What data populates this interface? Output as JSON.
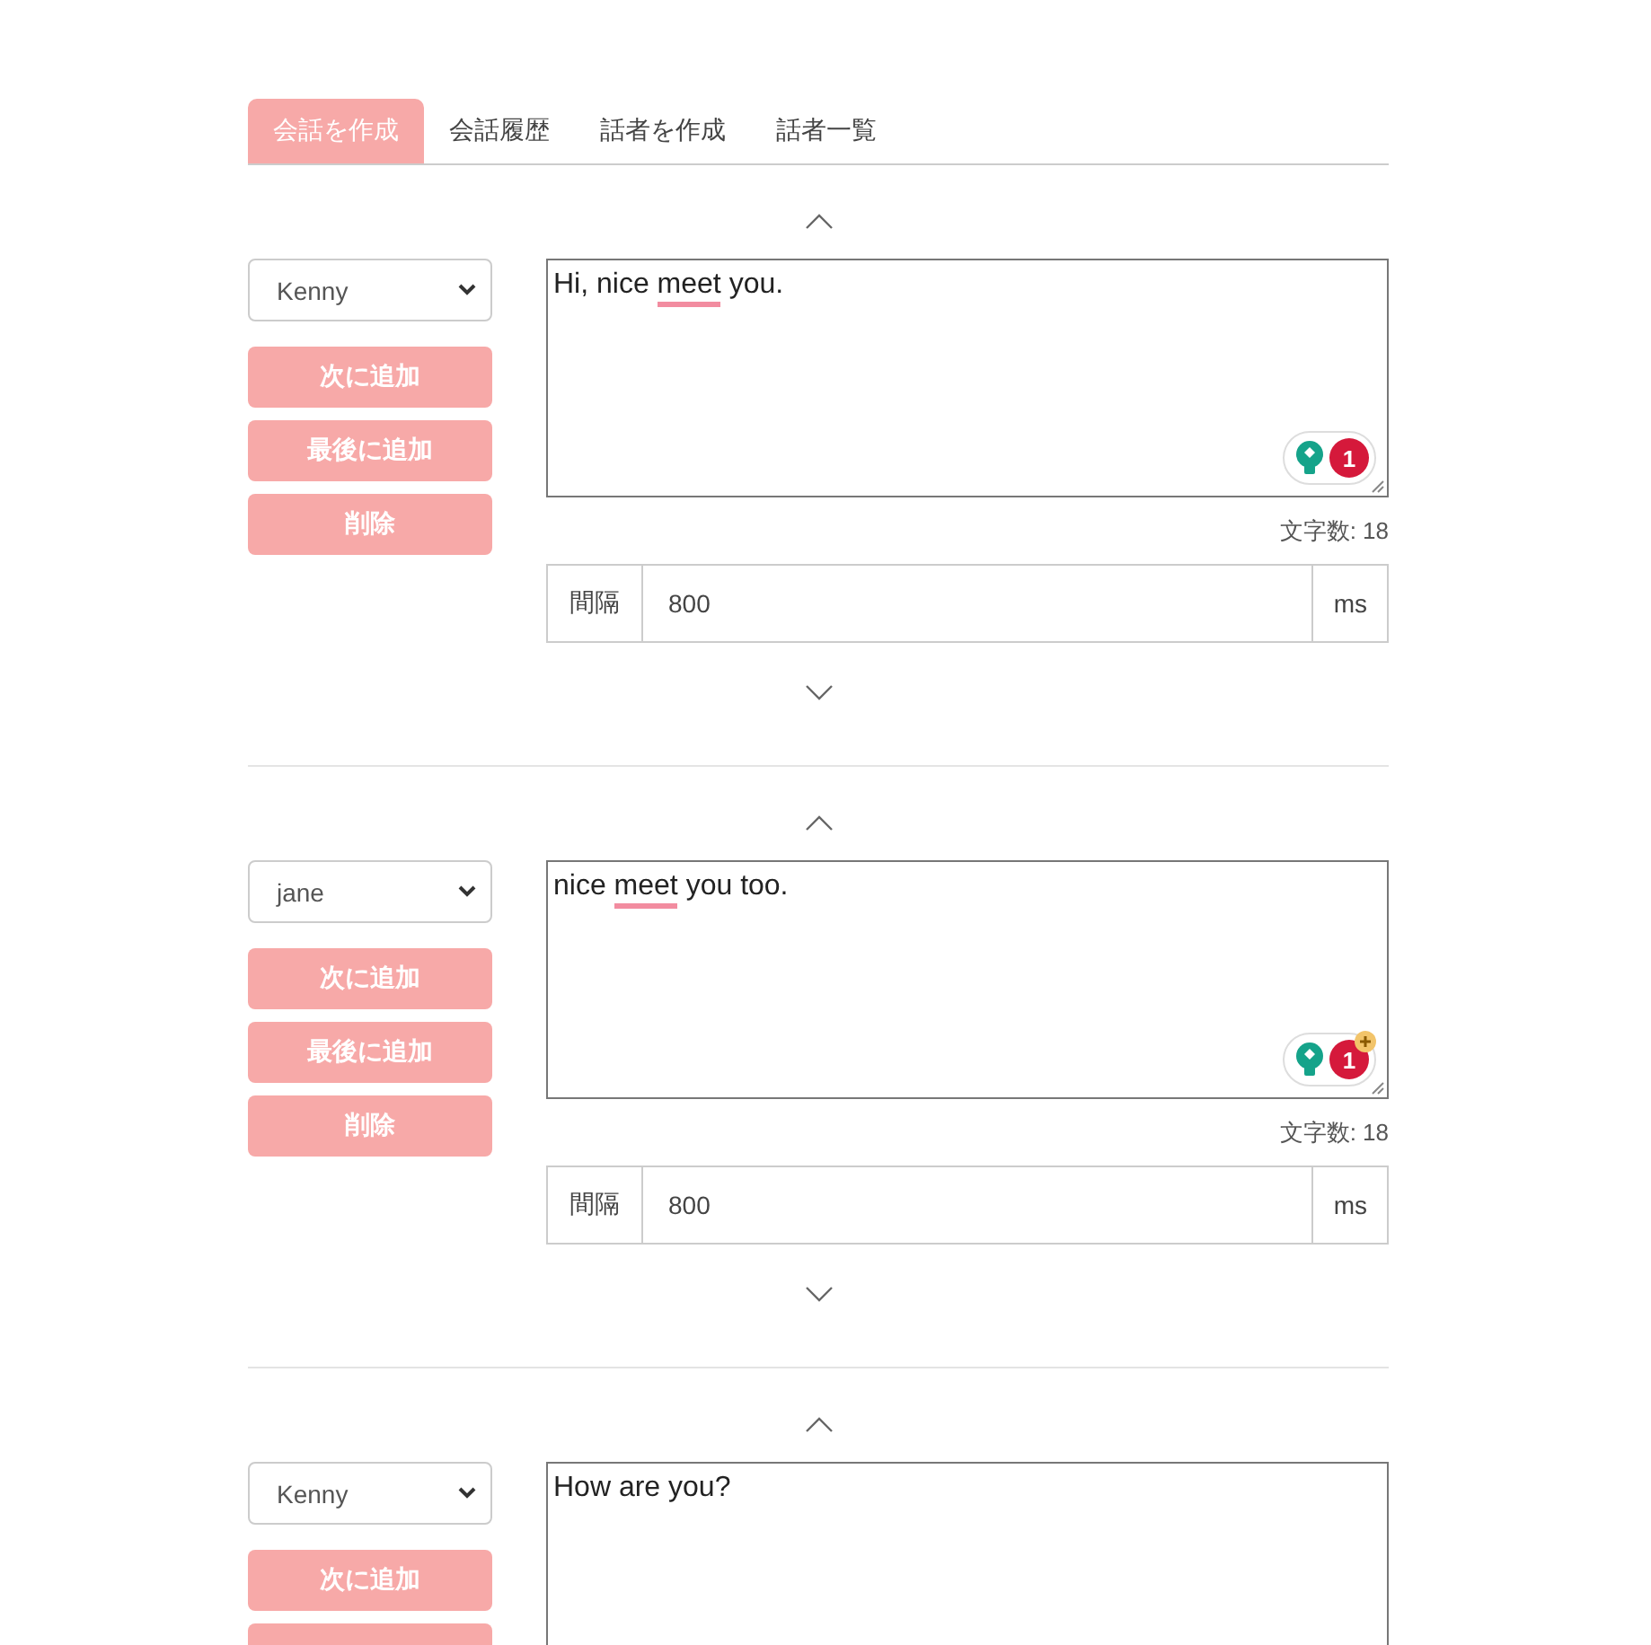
{
  "tabs": [
    {
      "label": "会話を作成",
      "selected": true
    },
    {
      "label": "会話履歴",
      "selected": false
    },
    {
      "label": "話者を作成",
      "selected": false
    },
    {
      "label": "話者一覧",
      "selected": false
    }
  ],
  "entries": [
    {
      "speaker": "Kenny",
      "buttons": [
        "次に追加",
        "最後に追加",
        "削除"
      ],
      "text": [
        {
          "text": "Hi, nice ",
          "flagged": false
        },
        {
          "text": "meet",
          "flagged": true
        },
        {
          "text": " you.",
          "flagged": false
        }
      ],
      "assistant": {
        "count": "1",
        "plus": false
      },
      "char_count": "文字数: 18",
      "interval": {
        "label": "間隔",
        "value": "800",
        "unit": "ms"
      }
    },
    {
      "speaker": "jane",
      "buttons": [
        "次に追加",
        "最後に追加",
        "削除"
      ],
      "text": [
        {
          "text": "nice ",
          "flagged": false
        },
        {
          "text": "meet",
          "flagged": true
        },
        {
          "text": " you too.",
          "flagged": false
        }
      ],
      "assistant": {
        "count": "1",
        "plus": true
      },
      "char_count": "文字数: 18",
      "interval": {
        "label": "間隔",
        "value": "800",
        "unit": "ms"
      }
    },
    {
      "speaker": "Kenny",
      "buttons": [
        "次に追加"
      ],
      "cut_button": true,
      "text": [
        {
          "text": "How are you?",
          "flagged": false
        }
      ]
    }
  ]
}
